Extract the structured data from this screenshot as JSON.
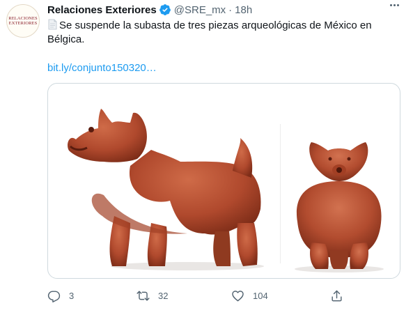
{
  "tweet": {
    "avatar_lines": [
      "RELACIONES",
      "EXTERIORES"
    ],
    "display_name": "Relaciones Exteriores",
    "handle": "@SRE_mx",
    "separator": "·",
    "time": "18h",
    "text": "Se suspende la subasta de tres piezas arqueológicas de México en Bélgica.",
    "text_icon": "document-emoji-icon",
    "link": "bit.ly/conjunto150320…",
    "media_alt": "Two views of a red ceramic pre-Columbian dog figure",
    "colors": {
      "name": "#0f1419",
      "secondary": "#536471",
      "link": "#1d9bf0",
      "verified": "#1d9bf0",
      "border": "#cfd9de",
      "figure_clay": "#b0492d"
    }
  },
  "actions": {
    "reply": {
      "icon": "reply-icon",
      "count": "3"
    },
    "retweet": {
      "icon": "retweet-icon",
      "count": "32"
    },
    "like": {
      "icon": "heart-icon",
      "count": "104"
    },
    "share": {
      "icon": "share-icon"
    }
  }
}
